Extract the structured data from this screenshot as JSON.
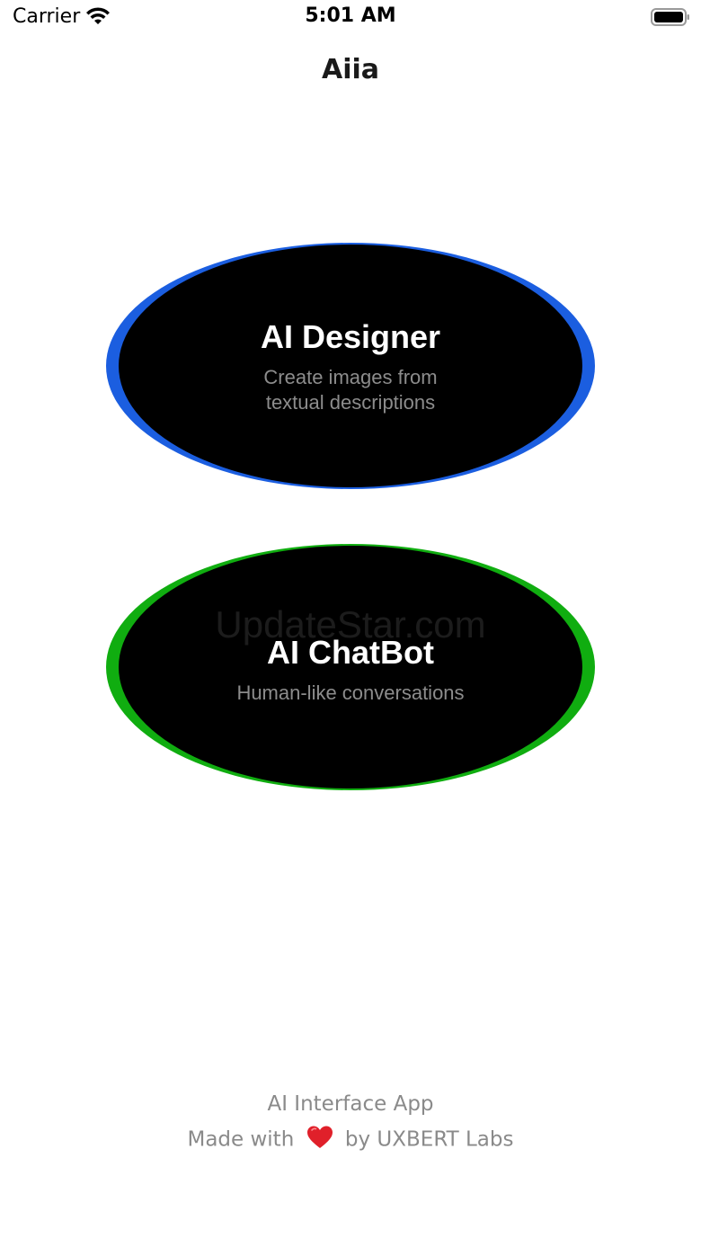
{
  "status_bar": {
    "carrier": "Carrier",
    "time": "5:01 AM",
    "wifi_icon": "wifi-icon",
    "battery_icon": "battery-icon"
  },
  "nav": {
    "title": "Aiia"
  },
  "cards": [
    {
      "title": "AI Designer",
      "subtitle_line1": "Create images from",
      "subtitle_line2": "textual descriptions",
      "accent_color": "#1b5ee0"
    },
    {
      "title": "AI ChatBot",
      "subtitle_line1": "Human-like conversations",
      "accent_color": "#10ad10",
      "watermark": "UpdateStar.com"
    }
  ],
  "footer": {
    "app_name": "AI Interface App",
    "made_with": "Made with",
    "heart_icon": "heart-icon",
    "by": "by UXBERT Labs"
  }
}
